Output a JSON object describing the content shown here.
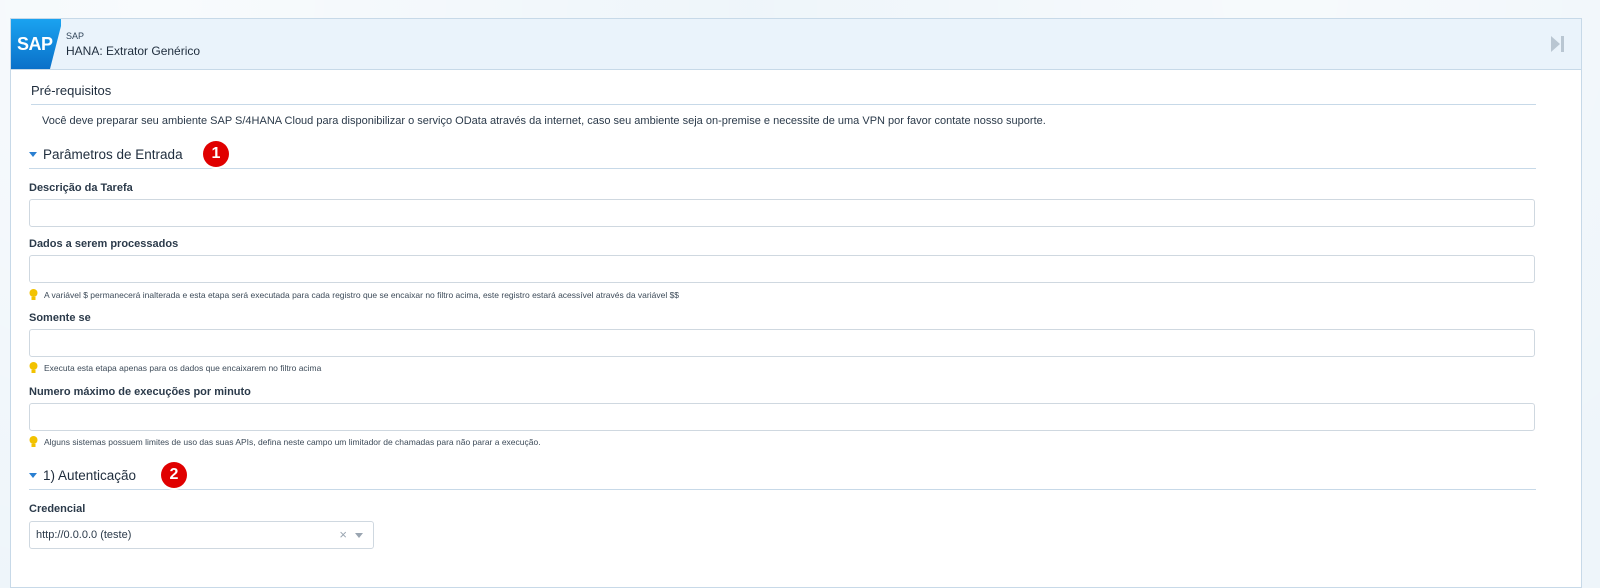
{
  "header": {
    "logo_text": "SAP",
    "small_label": "SAP",
    "title": "HANA: Extrator Genérico",
    "icon": "skip-forward-icon"
  },
  "prereq": {
    "title": "Pré-requisitos",
    "text": "Você deve preparar seu ambiente SAP S/4HANA Cloud para disponibilizar o serviço OData através da internet, caso seu ambiente seja on-premise e necessite de uma VPN por favor contate nosso suporte."
  },
  "section1": {
    "title": "Parâmetros de Entrada",
    "badge": "1",
    "fields": [
      {
        "label": "Descrição da Tarefa",
        "value": "",
        "hint": ""
      },
      {
        "label": "Dados a serem processados",
        "value": "",
        "hint": "A variável $ permanecerá inalterada e esta etapa será executada para cada registro que se encaixar no filtro acima, este registro estará acessível através da variável $$"
      },
      {
        "label": "Somente se",
        "value": "",
        "hint": "Executa esta etapa apenas para os dados que encaixarem no filtro acima"
      },
      {
        "label": "Numero máximo de execuções por minuto",
        "value": "",
        "hint": "Alguns sistemas possuem limites de uso das suas APIs, defina neste campo um limitador de chamadas para não parar a execução."
      }
    ]
  },
  "section2": {
    "title": "1) Autenticação",
    "badge": "2",
    "credential_label": "Credencial",
    "credential_value": "http://0.0.0.0 (teste)",
    "clear_glyph": "×"
  },
  "colors": {
    "accent": "#2a7fd1",
    "badge": "#e00000",
    "header_bg": "#eaf3fb",
    "border": "#c7d9e8"
  }
}
